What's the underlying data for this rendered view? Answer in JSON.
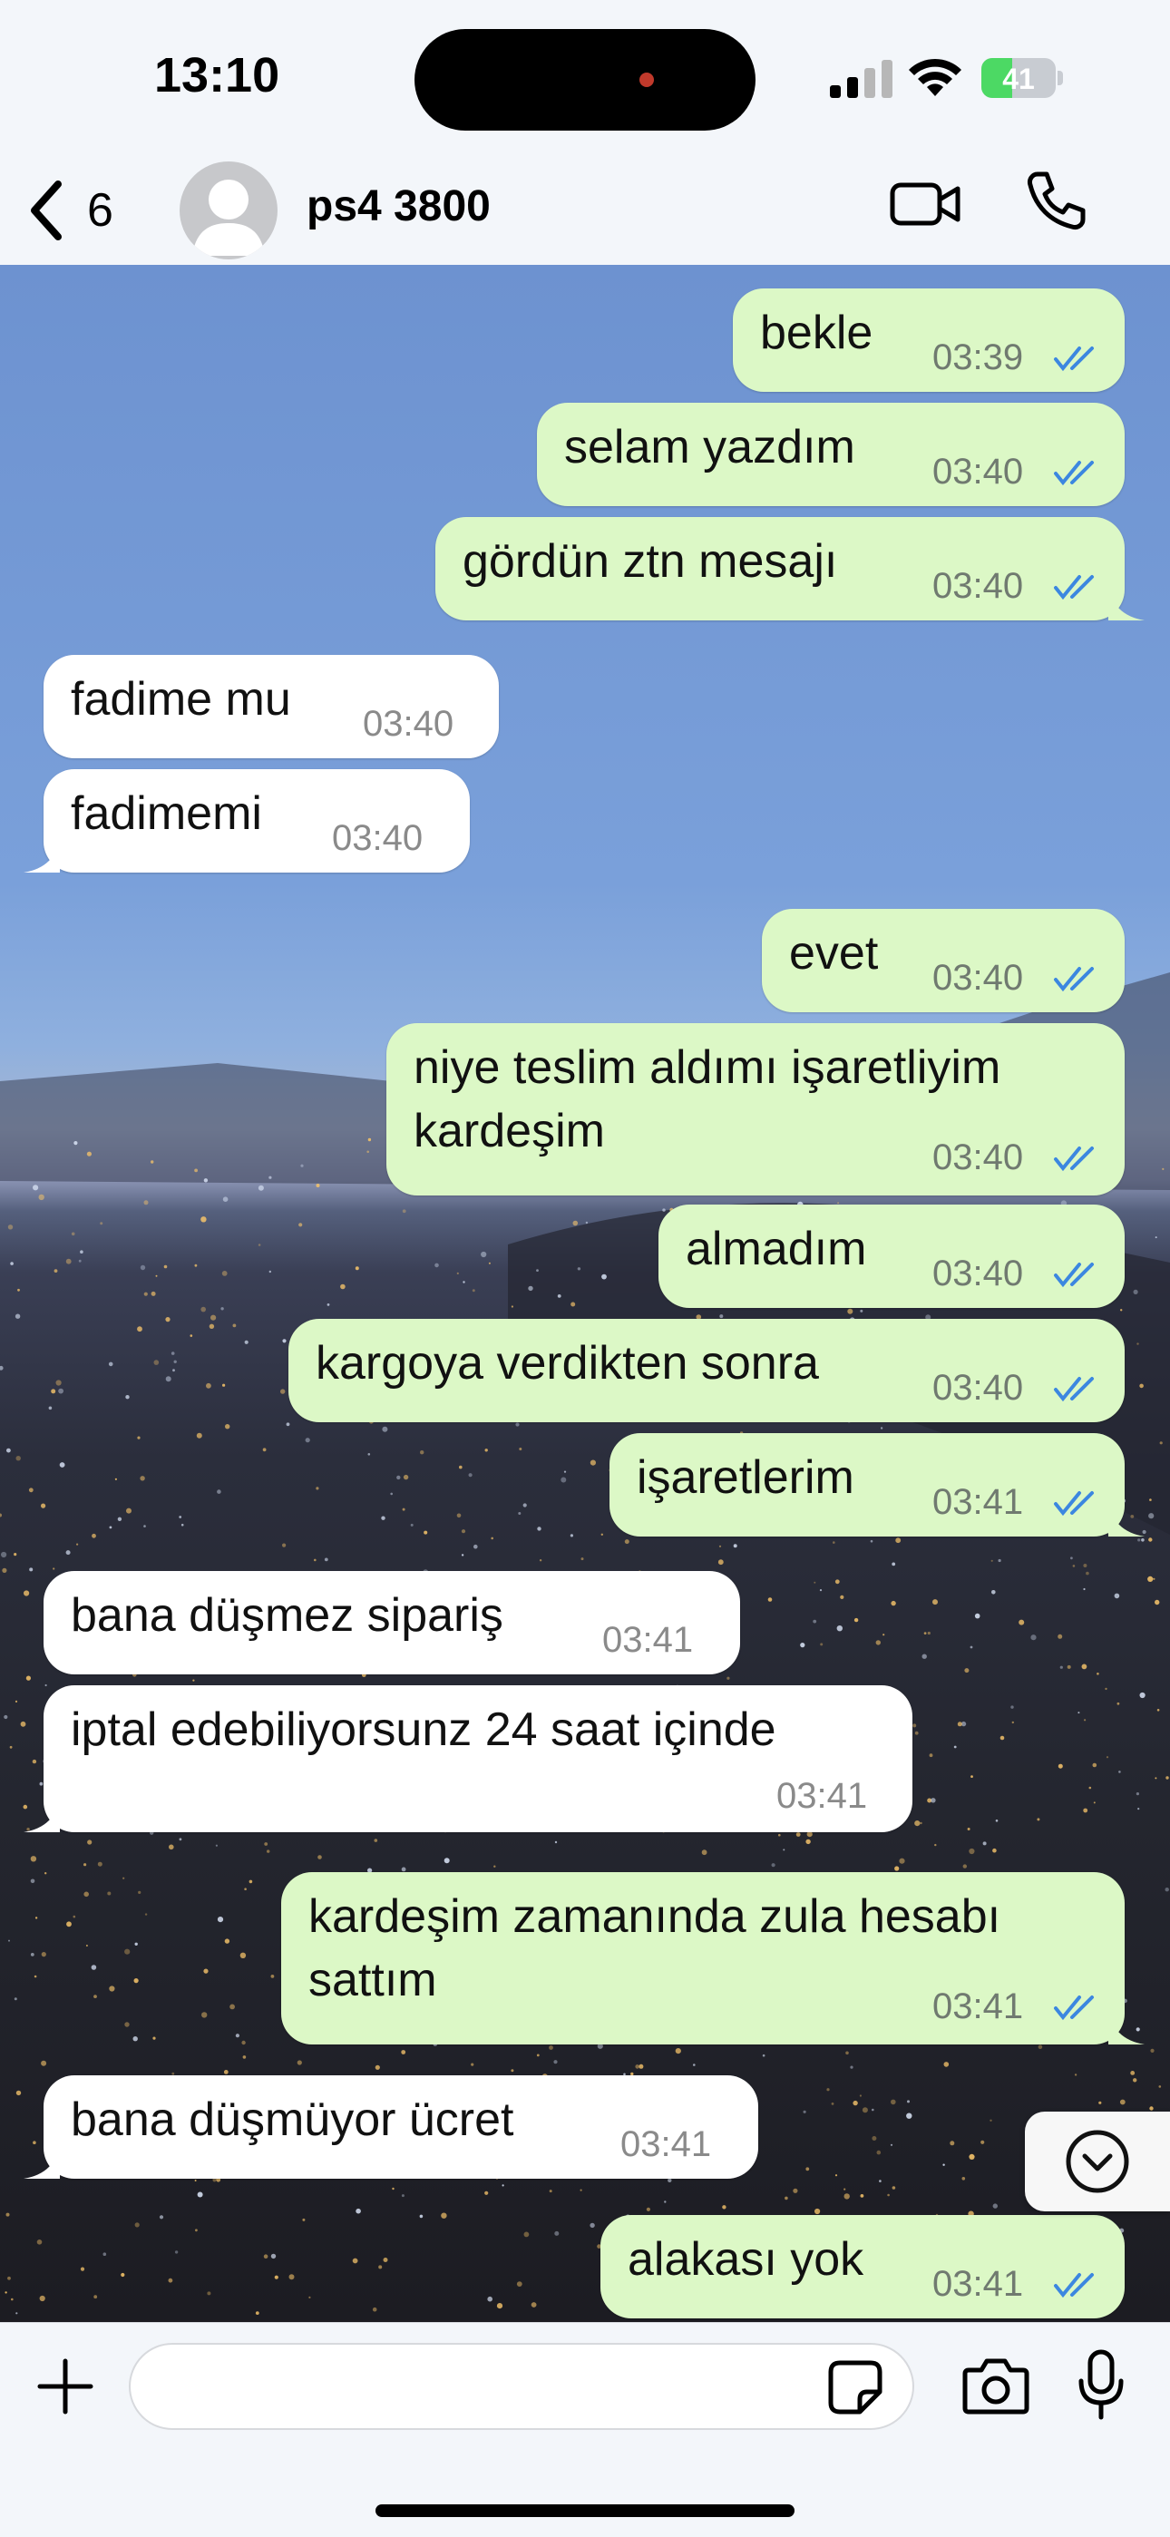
{
  "status_bar": {
    "time": "13:10",
    "battery": "41",
    "battery_level": 0.41
  },
  "header": {
    "back_count": "6",
    "contact_name": "ps4 3800"
  },
  "messages": [
    {
      "text": "bekle",
      "time": "03:39",
      "direction": "out"
    },
    {
      "text": "selam yazdım",
      "time": "03:40",
      "direction": "out"
    },
    {
      "text": "gördün ztn mesajı",
      "time": "03:40",
      "direction": "out"
    },
    {
      "text": "fadime mu",
      "time": "03:40",
      "direction": "in"
    },
    {
      "text": "fadimemi",
      "time": "03:40",
      "direction": "in"
    },
    {
      "text": "evet",
      "time": "03:40",
      "direction": "out"
    },
    {
      "text": "niye teslim aldımı işaretliyim",
      "text2": "kardeşim",
      "time": "03:40",
      "direction": "out"
    },
    {
      "text": "almadım",
      "time": "03:40",
      "direction": "out"
    },
    {
      "text": "kargoya verdikten sonra",
      "time": "03:40",
      "direction": "out"
    },
    {
      "text": "işaretlerim",
      "time": "03:41",
      "direction": "out"
    },
    {
      "text": "bana düşmez sipariş",
      "time": "03:41",
      "direction": "in"
    },
    {
      "text": "iptal edebiliyorsunz 24 saat içinde",
      "time": "03:41",
      "direction": "in"
    },
    {
      "text": "kardeşim zamanında zula hesabı",
      "text2": "sattım",
      "time": "03:41",
      "direction": "out"
    },
    {
      "text": "bana düşmüyor ücret",
      "time": "03:41",
      "direction": "in"
    },
    {
      "text": "alakası yok",
      "time": "03:41",
      "direction": "out"
    }
  ],
  "input": {
    "value": "",
    "placeholder": ""
  },
  "colors": {
    "outgoing": "#dcf8c6",
    "incoming": "#ffffff",
    "read_ticks": "#3c87e0"
  },
  "icons": [
    "chevron-left-icon",
    "avatar-icon",
    "video-call-icon",
    "phone-icon",
    "chevron-down-circle-icon",
    "plus-icon",
    "sticker-icon",
    "camera-icon",
    "microphone-icon"
  ]
}
